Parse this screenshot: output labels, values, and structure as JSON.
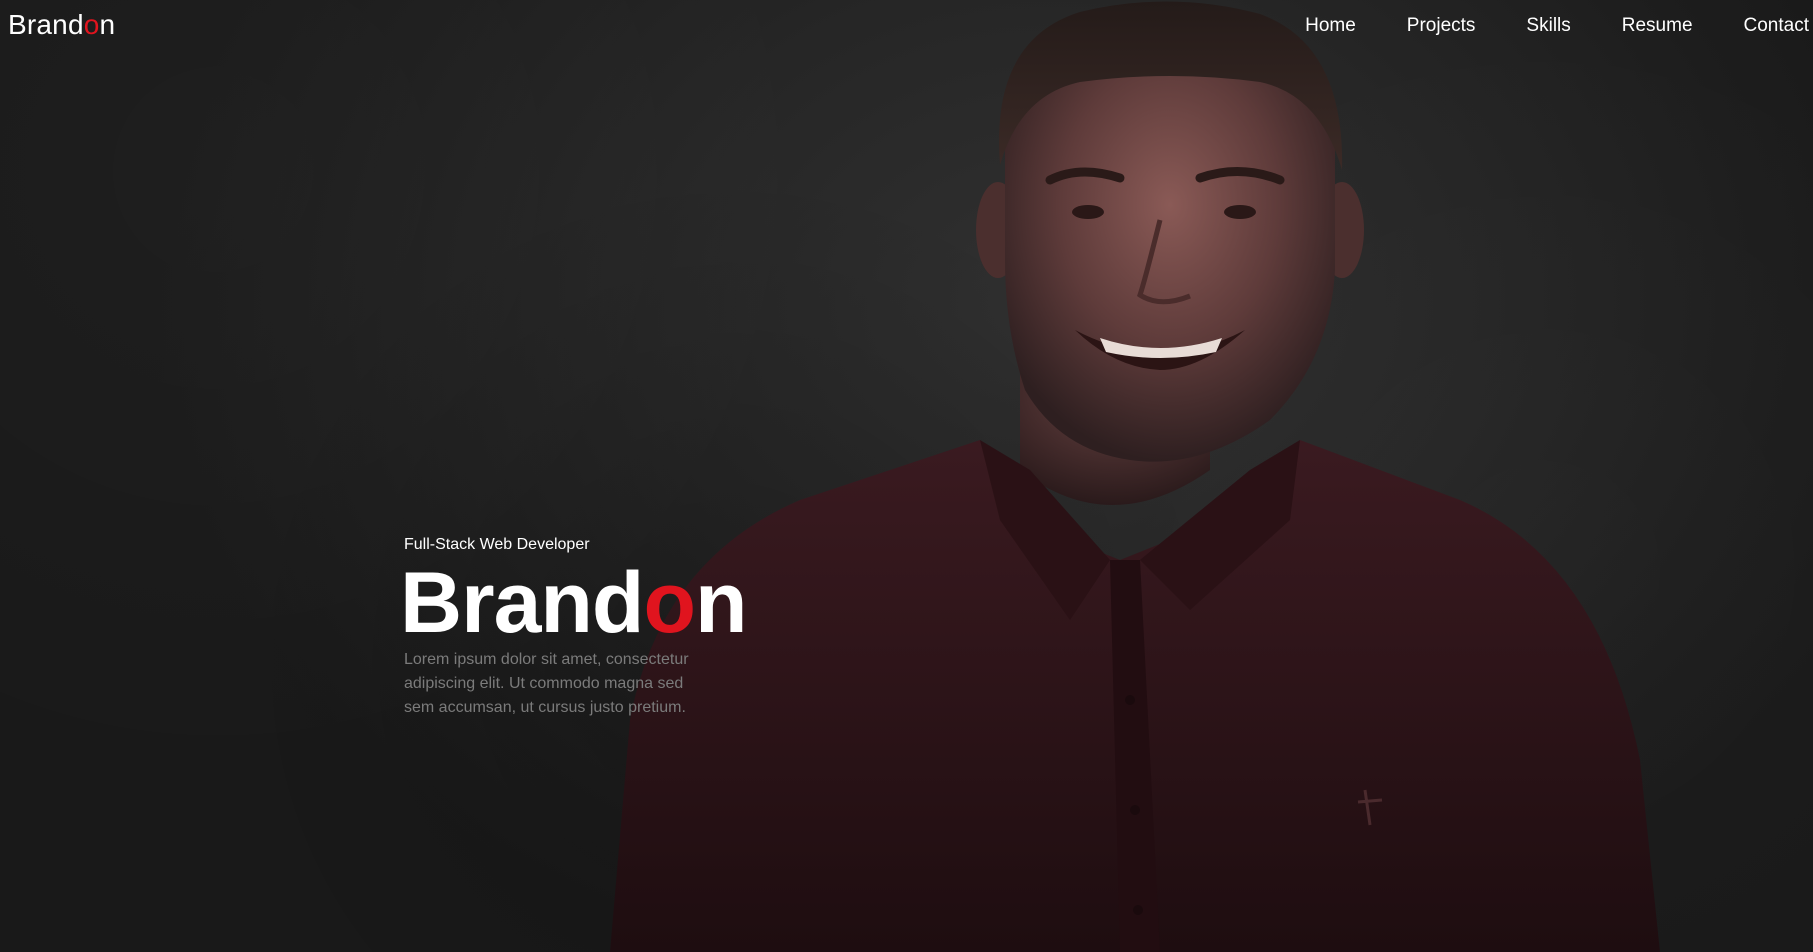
{
  "logo": {
    "text_before": "Brand",
    "accent": "o",
    "text_after": "n"
  },
  "nav": {
    "items": [
      {
        "label": "Home"
      },
      {
        "label": "Projects"
      },
      {
        "label": "Skills"
      },
      {
        "label": "Resume"
      },
      {
        "label": "Contact"
      }
    ]
  },
  "hero": {
    "subtitle": "Full-Stack Web Developer",
    "name_before": "Brand",
    "name_accent": "o",
    "name_after": "n",
    "description": "Lorem ipsum dolor sit amet, consectetur adipiscing elit. Ut commodo magna sed sem accumsan, ut cursus justo pretium."
  },
  "colors": {
    "accent": "#e0141e",
    "background": "#262626",
    "shirt": "#2e1419",
    "muted_text": "#7b7b7b"
  },
  "icons": {
    "portrait": "person-portrait-photo"
  }
}
